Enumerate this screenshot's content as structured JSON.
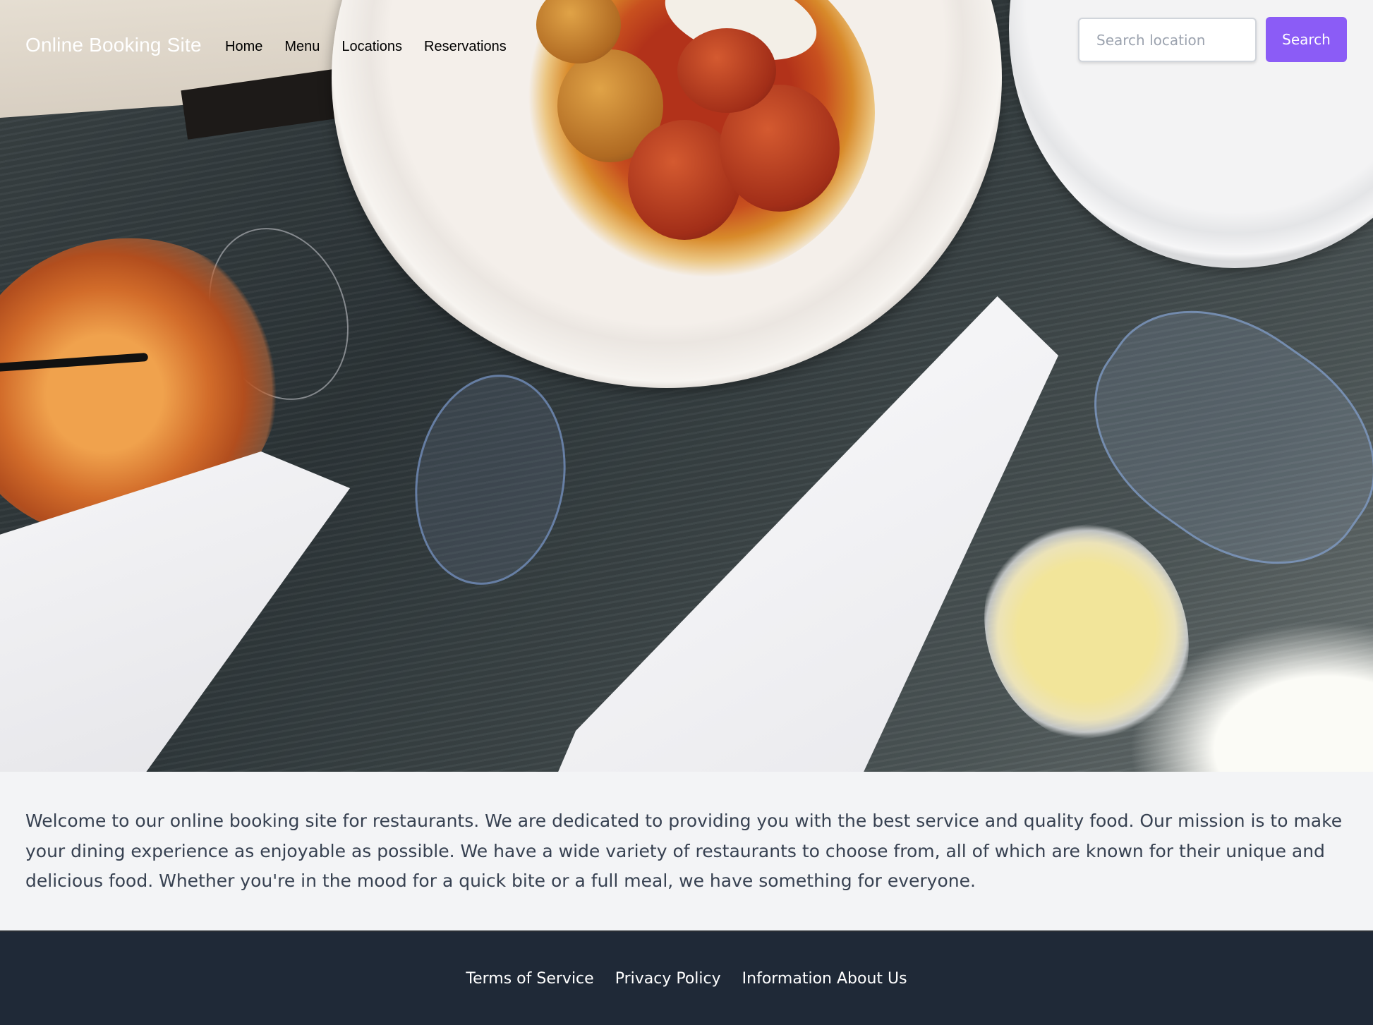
{
  "header": {
    "brand": "Online Booking Site",
    "nav": [
      {
        "label": "Home"
      },
      {
        "label": "Menu"
      },
      {
        "label": "Locations"
      },
      {
        "label": "Reservations"
      }
    ],
    "search": {
      "value": "",
      "placeholder": "Search location",
      "button_label": "Search"
    }
  },
  "hero": {
    "image_description": "restaurant-table-food-photo"
  },
  "main": {
    "intro": "Welcome to our online booking site for restaurants. We are dedicated to providing you with the best service and quality food. Our mission is to make your dining experience as enjoyable as possible. We have a wide variety of restaurants to choose from, all of which are known for their unique and delicious food. Whether you're in the mood for a quick bite or a full meal, we have something for everyone."
  },
  "footer": {
    "links": [
      {
        "label": "Terms of Service"
      },
      {
        "label": "Privacy Policy"
      },
      {
        "label": "Information About Us"
      }
    ]
  },
  "colors": {
    "accent": "#8b5cf6",
    "page_bg": "#f3f4f6",
    "footer_bg": "#1f2937",
    "body_text": "#374151"
  }
}
